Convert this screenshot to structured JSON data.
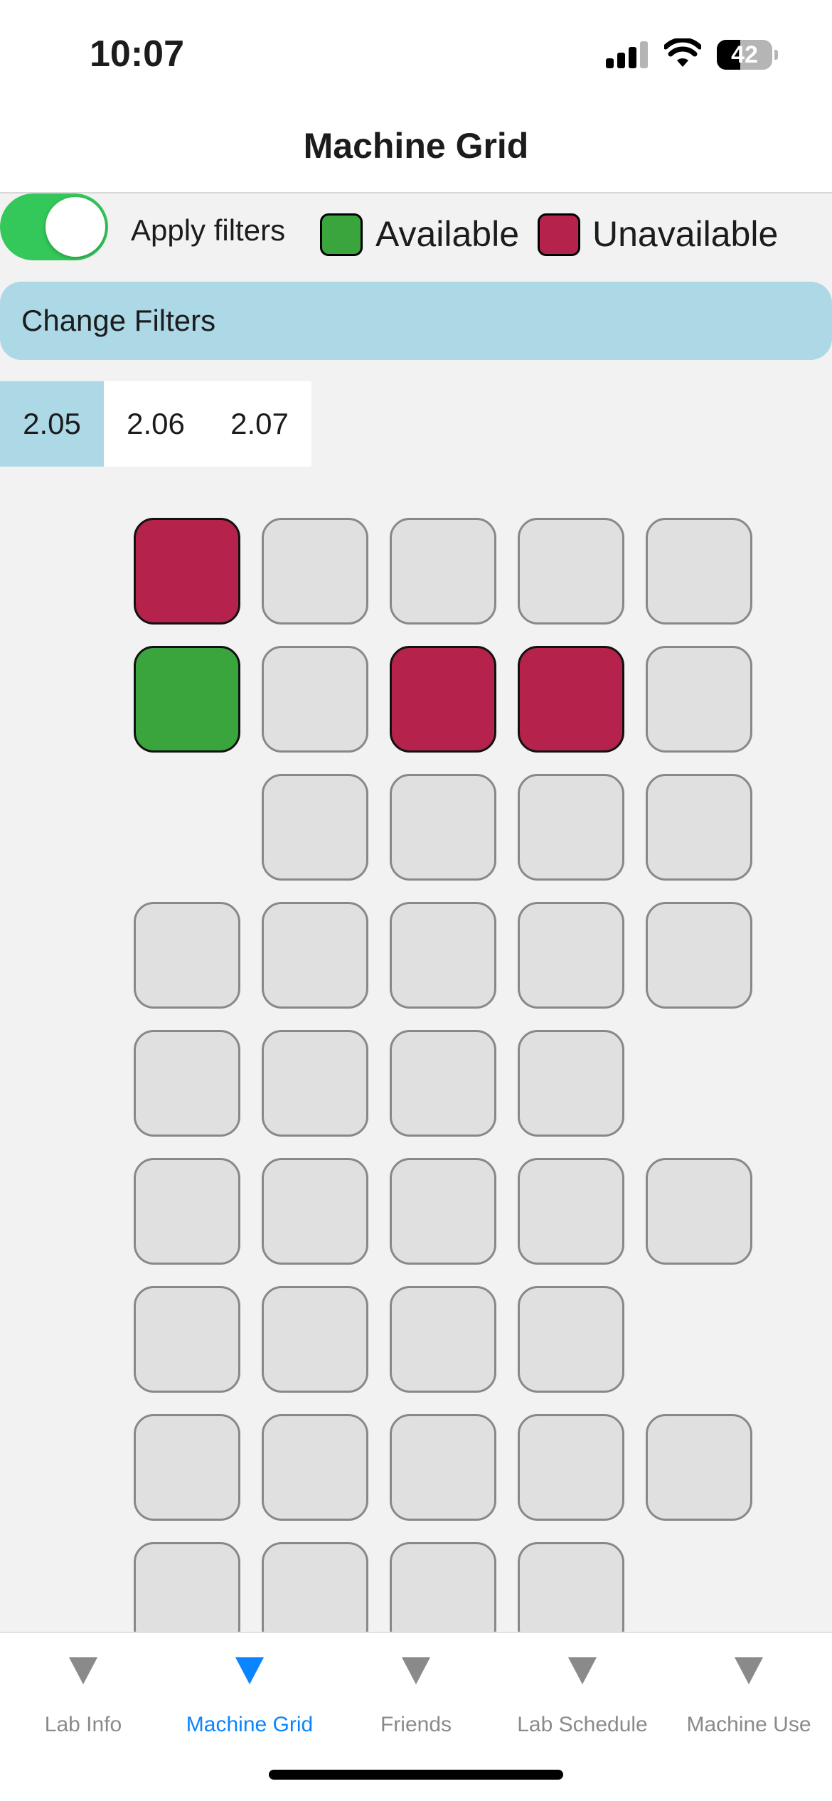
{
  "status_bar": {
    "time": "10:07",
    "battery_level": "42",
    "battery_fraction": 0.42
  },
  "header": {
    "title": "Machine Grid"
  },
  "filters": {
    "toggle_on": true,
    "apply_label": "Apply filters",
    "legend": [
      {
        "label": "Available",
        "color": "#3aa53d"
      },
      {
        "label": "Unavailable",
        "color": "#b5224c"
      }
    ],
    "change_button": "Change Filters"
  },
  "room_tabs": [
    {
      "label": "2.05",
      "selected": true
    },
    {
      "label": "2.06",
      "selected": false
    },
    {
      "label": "2.07",
      "selected": false
    }
  ],
  "grid": {
    "rows": [
      [
        "unavailable",
        "empty",
        "empty",
        "empty",
        "empty"
      ],
      [
        "available",
        "empty",
        "unavailable",
        "unavailable",
        "empty"
      ],
      [
        null,
        "empty",
        "empty",
        "empty",
        "empty"
      ],
      [
        "empty",
        "empty",
        "empty",
        "empty",
        "empty"
      ],
      [
        "empty",
        "empty",
        "empty",
        "empty",
        null
      ],
      [
        "empty",
        "empty",
        "empty",
        "empty",
        "empty"
      ],
      [
        "empty",
        "empty",
        "empty",
        "empty",
        null
      ],
      [
        "empty",
        "empty",
        "empty",
        "empty",
        "empty"
      ],
      [
        "empty",
        "empty",
        "empty",
        "empty",
        null
      ]
    ]
  },
  "tab_bar": {
    "items": [
      {
        "label": "Lab Info",
        "icon": "triangle-down-icon",
        "active": false
      },
      {
        "label": "Machine Grid",
        "icon": "triangle-down-icon",
        "active": true
      },
      {
        "label": "Friends",
        "icon": "triangle-down-icon",
        "active": false
      },
      {
        "label": "Lab Schedule",
        "icon": "triangle-down-icon",
        "active": false
      },
      {
        "label": "Machine Use",
        "icon": "triangle-down-icon",
        "active": false
      }
    ]
  },
  "colors": {
    "accent": "#0a84ff",
    "toggle": "#34c759",
    "selected_tab": "#add8e6"
  }
}
